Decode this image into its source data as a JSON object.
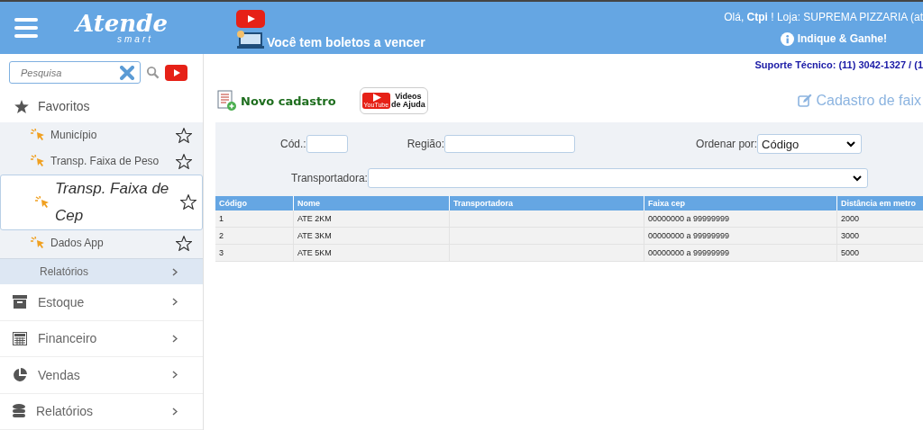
{
  "header": {
    "logo": {
      "name": "Atende",
      "tagline": "smart"
    },
    "notice": "Você tem boletos a vencer",
    "greeting": "Olá, **Ctpi** !  Loja: SUPREMA PIZZARIA (at",
    "referral": "Indique & Ganhe!"
  },
  "sidebar": {
    "search": {
      "placeholder": "Pesquisa"
    },
    "favorites": {
      "label": "Favoritos",
      "items": [
        {
          "label": "Município",
          "selected": false
        },
        {
          "label": "Transp. Faixa de Peso",
          "selected": false
        },
        {
          "label": "Transp. Faixa de Cep",
          "selected": true
        },
        {
          "label": "Dados App",
          "selected": false
        }
      ]
    },
    "submenu": {
      "label": "Relatórios"
    },
    "menu": [
      {
        "label": "Estoque",
        "kind": "box"
      },
      {
        "label": "Financeiro",
        "kind": "calc"
      },
      {
        "label": "Vendas",
        "kind": "pie"
      },
      {
        "label": "Relatórios",
        "kind": "db"
      }
    ]
  },
  "support": "Suporte Técnico: (11) 3042-1327 / (1",
  "toolbar": {
    "new": "Novo cadastro",
    "video_top": "Videos",
    "video_bottom": "de Ajuda",
    "video_brand": "YouTube",
    "title": "Cadastro de faix"
  },
  "filters": {
    "code_label": "Cód.:",
    "region_label": "Região:",
    "order_label": "Ordenar por:",
    "order_value": "Código",
    "carrier_label": "Transportadora:"
  },
  "table": {
    "columns": [
      "Código",
      "Nome",
      "Transportadora",
      "Faixa cep",
      "Distância em metro"
    ],
    "rows": [
      [
        "1",
        "ATE 2KM",
        "",
        "00000000 a 99999999",
        "2000"
      ],
      [
        "2",
        "ATE 3KM",
        "",
        "00000000 a 99999999",
        "3000"
      ],
      [
        "3",
        "ATE 5KM",
        "",
        "00000000 a 99999999",
        "5000"
      ]
    ]
  }
}
